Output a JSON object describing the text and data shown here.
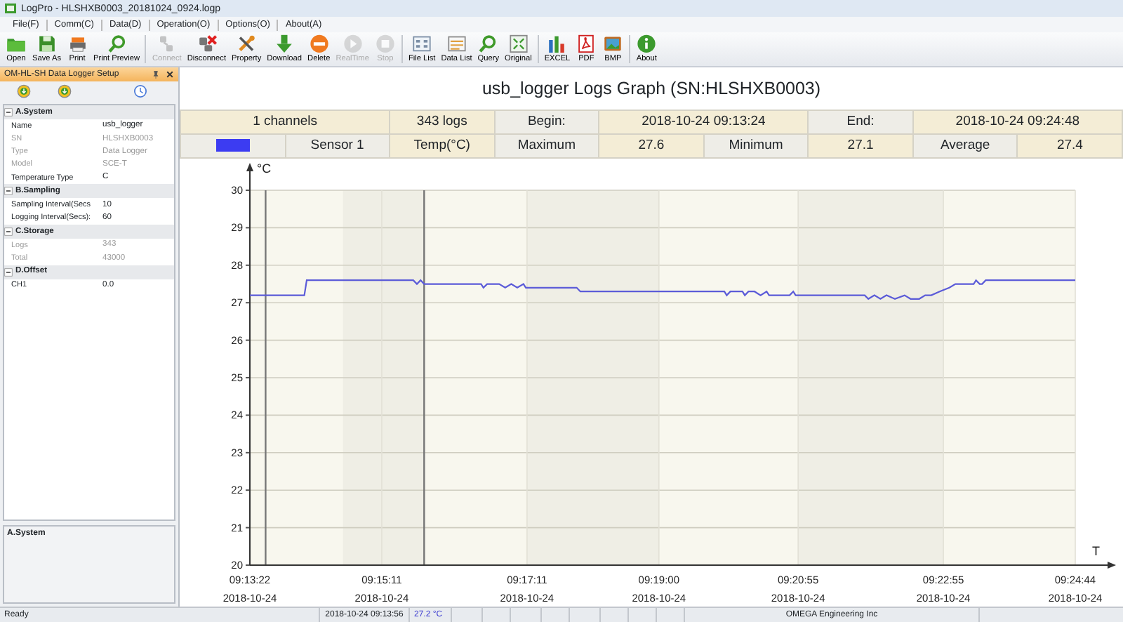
{
  "window": {
    "title": "LogPro - HLSHXB0003_20181024_0924.logp"
  },
  "menu": [
    "File(F)",
    "Comm(C)",
    "Data(D)",
    "Operation(O)",
    "Options(O)",
    "About(A)"
  ],
  "toolbar": [
    {
      "label": "Open",
      "disabled": false
    },
    {
      "label": "Save As",
      "disabled": false
    },
    {
      "label": "Print",
      "disabled": false
    },
    {
      "label": "Print Preview",
      "disabled": false
    },
    {
      "label": "Connect",
      "disabled": true
    },
    {
      "label": "Disconnect",
      "disabled": false
    },
    {
      "label": "Property",
      "disabled": false
    },
    {
      "label": "Download",
      "disabled": false
    },
    {
      "label": "Delete",
      "disabled": false
    },
    {
      "label": "RealTime",
      "disabled": true
    },
    {
      "label": "Stop",
      "disabled": true
    },
    {
      "label": "File List",
      "disabled": false
    },
    {
      "label": "Data List",
      "disabled": false
    },
    {
      "label": "Query",
      "disabled": false
    },
    {
      "label": "Original",
      "disabled": false
    },
    {
      "label": "EXCEL",
      "disabled": false
    },
    {
      "label": "PDF",
      "disabled": false
    },
    {
      "label": "BMP",
      "disabled": false
    },
    {
      "label": "About",
      "disabled": false
    }
  ],
  "setup_panel": {
    "title": "OM-HL-SH Data Logger Setup",
    "categories": [
      {
        "name": "A.System",
        "expanded": true,
        "rows": [
          {
            "label": "Name",
            "value": "usb_logger",
            "disabled": false
          },
          {
            "label": "SN",
            "value": "HLSHXB0003",
            "disabled": true
          },
          {
            "label": "Type",
            "value": "Data Logger",
            "disabled": true
          },
          {
            "label": "Model",
            "value": "SCE-T",
            "disabled": true
          },
          {
            "label": "Temperature Type",
            "value": "C",
            "disabled": false
          }
        ]
      },
      {
        "name": "B.Sampling",
        "expanded": true,
        "rows": [
          {
            "label": "Sampling Interval(Secs",
            "value": "10",
            "disabled": false
          },
          {
            "label": "Logging Interval(Secs):",
            "value": "60",
            "disabled": false
          }
        ]
      },
      {
        "name": "C.Storage",
        "expanded": true,
        "rows": [
          {
            "label": "Logs",
            "value": "343",
            "disabled": true
          },
          {
            "label": "Total",
            "value": "43000",
            "disabled": true
          }
        ]
      },
      {
        "name": "D.Offset",
        "expanded": true,
        "rows": [
          {
            "label": "CH1",
            "value": "0.0",
            "disabled": false
          }
        ]
      }
    ],
    "description": "A.System"
  },
  "graph": {
    "title": "usb_logger Logs Graph (SN:HLSHXB0003)",
    "summary": [
      [
        {
          "text": "1 channels",
          "kind": "value"
        },
        {
          "text": "343 logs",
          "kind": "value"
        },
        {
          "text": "Begin:",
          "kind": "label"
        },
        {
          "text": "2018-10-24 09:13:24",
          "kind": "value"
        },
        {
          "text": "End:",
          "kind": "label"
        },
        {
          "text": "2018-10-24 09:24:48",
          "kind": "value"
        }
      ],
      [
        {
          "kind": "swatch",
          "color": "#3c3cf2"
        },
        {
          "text": "Sensor 1",
          "kind": "label"
        },
        {
          "text": "Temp(°C)",
          "kind": "value"
        },
        {
          "text": "Maximum",
          "kind": "label"
        },
        {
          "text": "27.6",
          "kind": "value"
        },
        {
          "text": "Minimum",
          "kind": "label"
        },
        {
          "text": "27.1",
          "kind": "value"
        },
        {
          "text": "Average",
          "kind": "label"
        },
        {
          "text": "27.4",
          "kind": "value"
        }
      ]
    ],
    "axis_dates": [
      "2018-10-24",
      "2018-10-24",
      "2018-10-24",
      "2018-10-24",
      "2018-10-24",
      "2018-10-24",
      "2018-10-24"
    ],
    "chart_data": {
      "type": "line",
      "grid": true,
      "bands": [
        {
          "axis": "x",
          "from": 33279,
          "to": 33347
        },
        {
          "axis": "x",
          "from": 33431,
          "to": 33540
        },
        {
          "axis": "x",
          "from": 33655,
          "to": 33775
        }
      ],
      "ref_lines": [
        {
          "axis": "x",
          "value": 33215
        },
        {
          "axis": "x",
          "value": 33346
        }
      ],
      "xlabel": "T",
      "ylabel": "°C",
      "ylim": [
        20,
        30
      ],
      "yticks": [
        20,
        21,
        22,
        23,
        24,
        25,
        26,
        27,
        28,
        29,
        30
      ],
      "xlim": [
        33202,
        33884
      ],
      "xticks": [
        {
          "value": 33202,
          "label": "09:13:22"
        },
        {
          "value": 33311,
          "label": "09:15:11"
        },
        {
          "value": 33431,
          "label": "09:17:11"
        },
        {
          "value": 33540,
          "label": "09:19:00"
        },
        {
          "value": 33655,
          "label": "09:20:55"
        },
        {
          "value": 33775,
          "label": "09:22:55"
        },
        {
          "value": 33884,
          "label": "09:24:44"
        }
      ],
      "x": [
        33202,
        33247,
        33249,
        33337,
        33340,
        33343,
        33346,
        33393,
        33395,
        33398,
        33408,
        33413,
        33418,
        33423,
        33428,
        33430,
        33472,
        33475,
        33594,
        33596,
        33599,
        33609,
        33611,
        33614,
        33619,
        33624,
        33629,
        33631,
        33648,
        33651,
        33653,
        33710,
        33713,
        33718,
        33723,
        33728,
        33735,
        33743,
        33748,
        33755,
        33760,
        33765,
        33772,
        33780,
        33785,
        33800,
        33802,
        33805,
        33807,
        33810,
        33884
      ],
      "series": [
        {
          "color": "#5b5bd8",
          "values": [
            27.2,
            27.2,
            27.6,
            27.6,
            27.5,
            27.6,
            27.5,
            27.5,
            27.4,
            27.5,
            27.5,
            27.4,
            27.5,
            27.4,
            27.5,
            27.4,
            27.4,
            27.3,
            27.3,
            27.2,
            27.3,
            27.3,
            27.2,
            27.3,
            27.3,
            27.2,
            27.3,
            27.2,
            27.2,
            27.3,
            27.2,
            27.2,
            27.1,
            27.2,
            27.1,
            27.2,
            27.1,
            27.2,
            27.1,
            27.1,
            27.2,
            27.2,
            27.3,
            27.4,
            27.5,
            27.5,
            27.6,
            27.5,
            27.5,
            27.6,
            27.6
          ]
        }
      ]
    }
  },
  "status_bar": {
    "state": "Ready",
    "time": "2018-10-24 09:13:56",
    "reading": "27.2 °C",
    "company": "OMEGA Engineering Inc"
  }
}
